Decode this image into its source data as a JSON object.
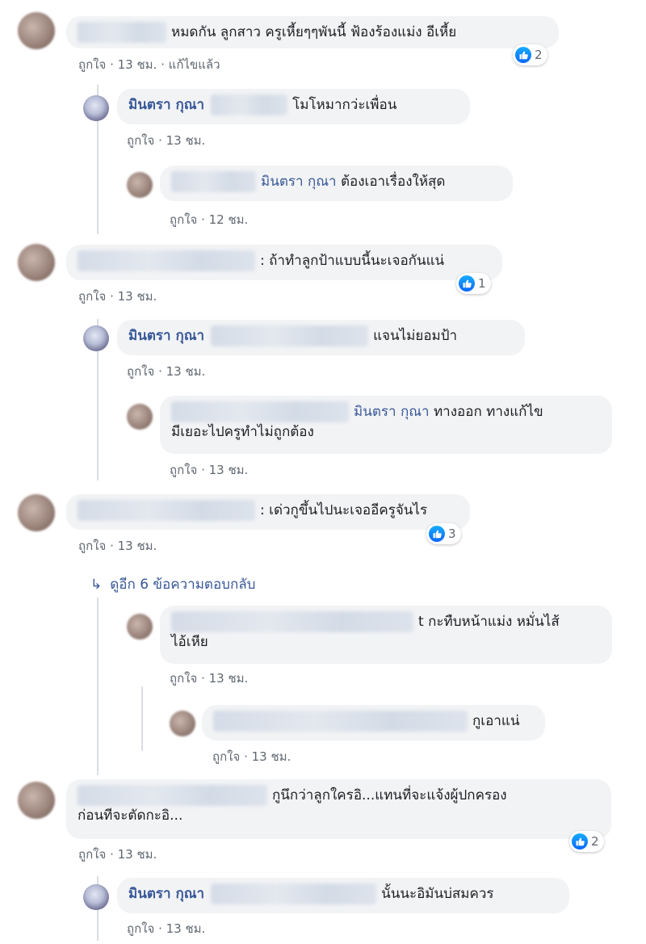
{
  "meta_common": {
    "like": "ถูกใจ",
    "dot": "·"
  },
  "comments": [
    {
      "text": "หมดกัน ลูกสาว ครูเหี้ยๆๆพันนี้ ฟ้องร้องแม่ง อีเหี้ย",
      "time": "13 ชม.",
      "edited": "แก้ไขแล้ว",
      "reactions": "2"
    },
    {
      "author": "มินตรา กุณา",
      "text": "โมโหมากว่ะเพื่อน",
      "time": "13 ชม."
    },
    {
      "tag": "มินตรา กุณา",
      "text": "ต้องเอาเรื่องให้สุด",
      "time": "12 ชม."
    },
    {
      "text": ": ถ้าทำลูกป้าแบบนี้นะเจอกันแน่",
      "time": "13 ชม.",
      "reactions": "1"
    },
    {
      "author": "มินตรา กุณา",
      "text": "แจนไม่ยอมป้า",
      "time": "13 ชม."
    },
    {
      "tag": "มินตรา กุณา",
      "text_line1": "ทางออก ทางแก้ไข",
      "text_line2": "มีเยอะไปครูทำไม่ถูกต้อง",
      "time": "13 ชม."
    },
    {
      "text": ": เด่วกูขึ้นไปนะเจออีครูจันไร",
      "time": "13 ชม.",
      "reactions": "3"
    },
    {
      "more_replies": "ดูอีก 6 ข้อความตอบกลับ"
    },
    {
      "text_line1": "t กะทืบหน้าแม่ง หมั่นไส้",
      "text_line2": "ไอ้เหีย",
      "time": "13 ชม."
    },
    {
      "text": "กูเอาแน่",
      "time": "13 ชม."
    },
    {
      "text_line1": "กูนึกว่าลูกใครอิ...แทนที่จะแจ้งผู้ปกครอง",
      "text_line2": "ก่อนทีจะตัดกะอิ...",
      "time": "13 ชม.",
      "reactions": "2"
    },
    {
      "author": "มินตรา กุณา",
      "text": "นั้นนะอิมันบ่สมควร",
      "time": "13 ชม."
    }
  ]
}
